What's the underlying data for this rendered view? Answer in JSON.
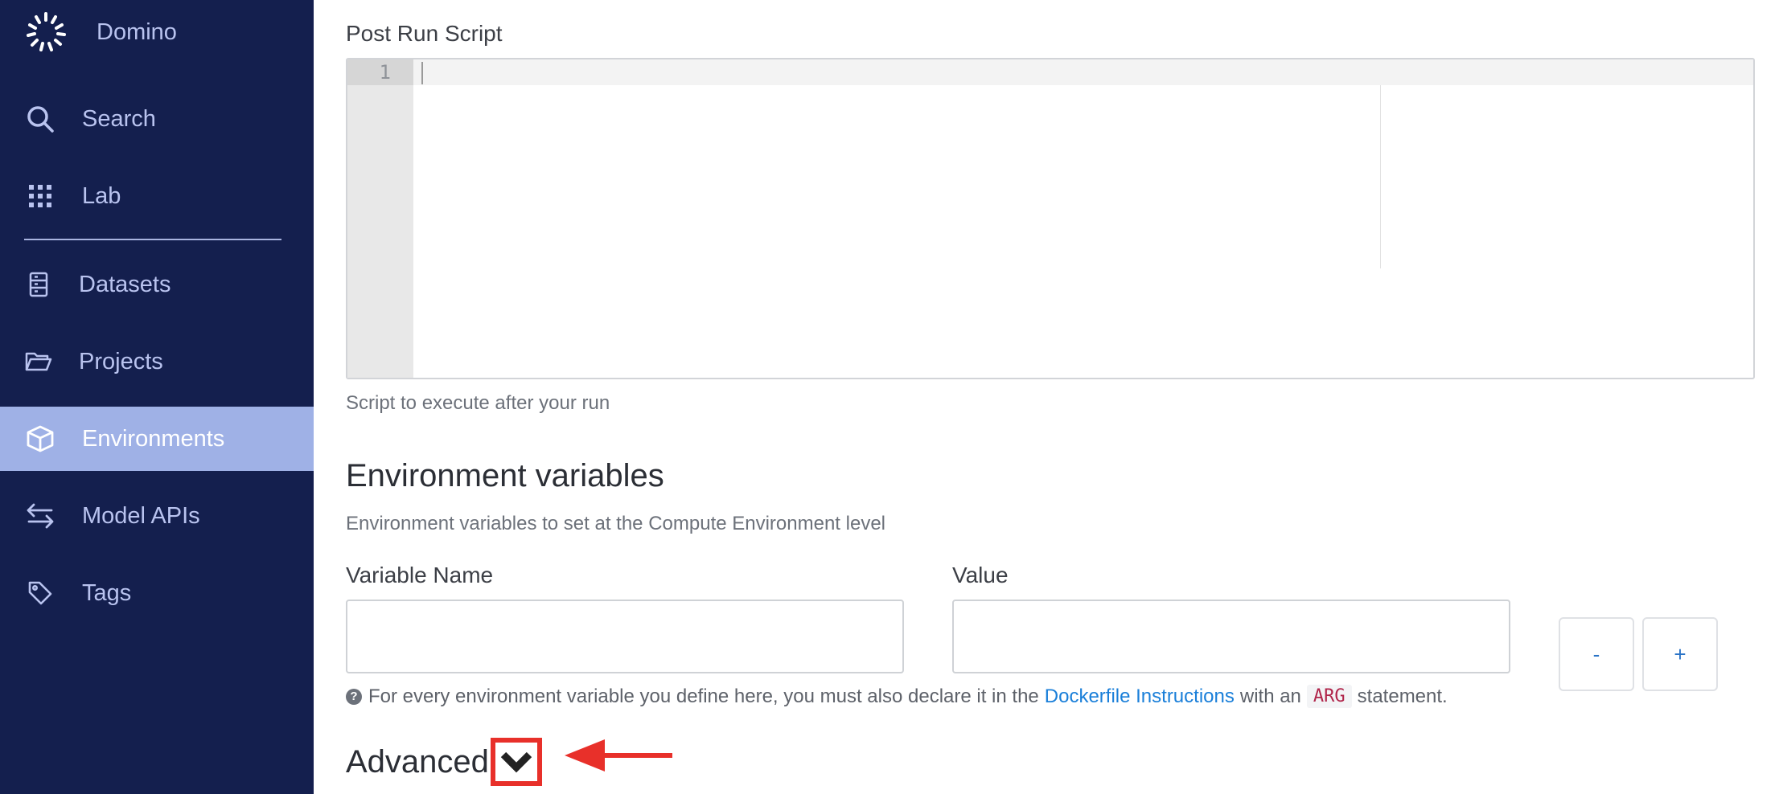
{
  "sidebar": {
    "brand": "Domino",
    "items": [
      {
        "label": "Search",
        "icon": "search-icon"
      },
      {
        "label": "Lab",
        "icon": "grid-icon"
      },
      {
        "label": "Datasets",
        "icon": "dataset-icon"
      },
      {
        "label": "Projects",
        "icon": "folder-icon"
      },
      {
        "label": "Environments",
        "icon": "cube-icon",
        "active": true
      },
      {
        "label": "Model APIs",
        "icon": "swap-arrows-icon"
      },
      {
        "label": "Tags",
        "icon": "tag-icon"
      }
    ]
  },
  "post_run": {
    "label": "Post Run Script",
    "line_number": "1",
    "help": "Script to execute after your run"
  },
  "env_vars": {
    "title": "Environment variables",
    "subtitle": "Environment variables to set at the Compute Environment level",
    "name_label": "Variable Name",
    "value_label": "Value",
    "name_value": "",
    "value_value": "",
    "remove_label": "-",
    "add_label": "+",
    "note_before": "For every environment variable you define here, you must also declare it in the",
    "note_link": "Dockerfile Instructions",
    "note_middle": "with an",
    "note_code": "ARG",
    "note_after": "statement."
  },
  "advanced": {
    "title": "Advanced"
  },
  "colors": {
    "sidebar_bg": "#141f4e",
    "sidebar_active": "#9fb1e6",
    "link": "#1a7fd9",
    "highlight": "#e8302a"
  }
}
